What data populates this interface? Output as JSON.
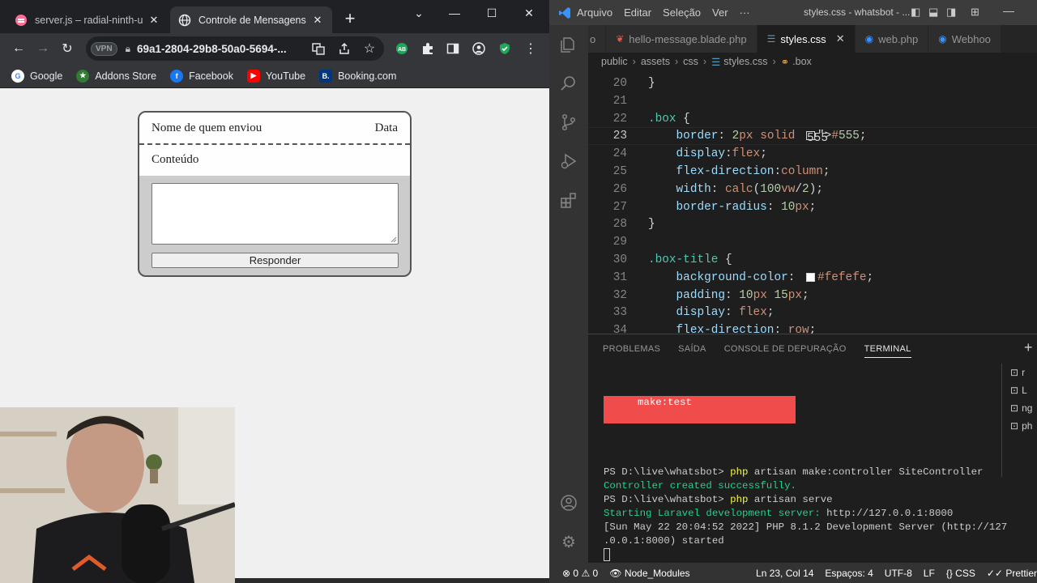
{
  "browser": {
    "tabs": [
      {
        "title": "server.js – radial-ninth-un",
        "active": false
      },
      {
        "title": "Controle de Mensagens d",
        "active": true
      }
    ],
    "url": "69a1-2804-29b8-50a0-5694-...",
    "vpn_label": "VPN",
    "bookmarks": [
      "Google",
      "Addons Store",
      "Facebook",
      "YouTube",
      "Booking.com"
    ]
  },
  "page": {
    "sender_label": "Nome de quem enviou",
    "date_label": "Data",
    "content_label": "Conteúdo",
    "reply_placeholder": "",
    "reply_button": "Responder"
  },
  "vscode": {
    "menu": [
      "Arquivo",
      "Editar",
      "Seleção",
      "Ver",
      "···"
    ],
    "window_title": "styles.css - whatsbot - ...",
    "tabs": [
      {
        "name": "o",
        "active": false
      },
      {
        "name": "hello-message.blade.php",
        "active": false
      },
      {
        "name": "styles.css",
        "active": true
      },
      {
        "name": "web.php",
        "active": false
      },
      {
        "name": "Webhoo",
        "active": false
      }
    ],
    "breadcrumbs": [
      "public",
      "assets",
      "css",
      "styles.css",
      ".box"
    ],
    "code_lines": [
      {
        "n": "20",
        "t": "}"
      },
      {
        "n": "21",
        "t": ""
      },
      {
        "n": "22",
        "t": ".box {"
      },
      {
        "n": "23",
        "t": "    border: 2px solid #555;"
      },
      {
        "n": "24",
        "t": "    display:flex;"
      },
      {
        "n": "25",
        "t": "    flex-direction:column;"
      },
      {
        "n": "26",
        "t": "    width: calc(100vw/2);"
      },
      {
        "n": "27",
        "t": "    border-radius: 10px;"
      },
      {
        "n": "28",
        "t": "}"
      },
      {
        "n": "29",
        "t": ""
      },
      {
        "n": "30",
        "t": ".box-title {"
      },
      {
        "n": "31",
        "t": "    background-color: #fefefe;"
      },
      {
        "n": "32",
        "t": "    padding: 10px 15px;"
      },
      {
        "n": "33",
        "t": "    display: flex;"
      },
      {
        "n": "34",
        "t": "    flex-direction: row;"
      }
    ],
    "panel_tabs": [
      "PROBLEMAS",
      "SAÍDA",
      "CONSOLE DE DEPURAÇÃO",
      "TERMINAL"
    ],
    "terminal": {
      "error_line": "make:test",
      "lines": [
        {
          "text": "PS D:\\live\\whatsbot> php artisan make:controller SiteController",
          "style": "normal"
        },
        {
          "text": "Controller created successfully.",
          "style": "green"
        },
        {
          "text": "PS D:\\live\\whatsbot> php artisan serve",
          "style": "normal"
        },
        {
          "text": "Starting Laravel development server: http://127.0.0.1:8000",
          "style": "green"
        },
        {
          "text": "[Sun May 22 20:04:52 2022] PHP 8.1.2 Development Server (http://127",
          "style": "normal"
        },
        {
          "text": ".0.0.1:8000) started",
          "style": "normal"
        }
      ],
      "sessions": [
        "r",
        "L",
        "ng",
        "ph"
      ]
    },
    "status": {
      "errors": "0",
      "warnings": "0",
      "folder": "Node_Modules",
      "position": "Ln 23, Col 14",
      "spaces": "Espaços: 4",
      "encoding": "UTF-8",
      "eol": "LF",
      "language": "CSS",
      "formatter": "Prettier"
    }
  },
  "colors": {
    "accent_red": "#f14c4c",
    "term_green": "#23d18b",
    "vscode_blue": "#3794ff"
  }
}
